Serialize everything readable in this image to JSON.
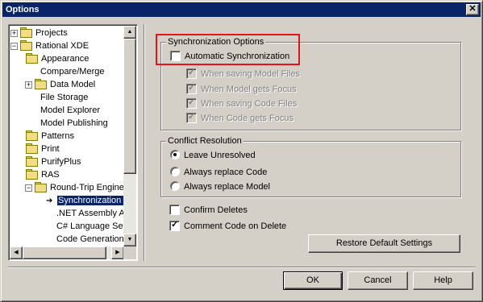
{
  "window": {
    "title": "Options",
    "close_glyph": "✕"
  },
  "tree": {
    "items": [
      {
        "label": "Projects",
        "icon": "folder-icon",
        "expander": "+"
      },
      {
        "label": "Rational XDE",
        "icon": "folder-icon",
        "expander": "−"
      },
      {
        "label": "Appearance",
        "icon": "folder-icon"
      },
      {
        "label": "Compare/Merge"
      },
      {
        "label": "Data Model",
        "icon": "folder-icon",
        "expander": "+"
      },
      {
        "label": "File Storage"
      },
      {
        "label": "Model Explorer"
      },
      {
        "label": "Model Publishing"
      },
      {
        "label": "Patterns",
        "icon": "folder-icon"
      },
      {
        "label": "Print",
        "icon": "folder-icon"
      },
      {
        "label": "PurifyPlus",
        "icon": "folder-icon"
      },
      {
        "label": "RAS",
        "icon": "folder-icon"
      },
      {
        "label": "Round-Trip Engineering",
        "icon": "folder-icon",
        "expander": "−"
      },
      {
        "label": "Synchronization S",
        "icon": "arrow-icon",
        "selected": true
      },
      {
        "label": ".NET Assembly At"
      },
      {
        "label": "C# Language Set"
      },
      {
        "label": "Code Generation"
      }
    ]
  },
  "sync_group": {
    "title": "Synchronization Options",
    "auto_sync": {
      "label": "Automatic Synchronization",
      "checked": false
    },
    "sub_options": [
      {
        "label": "When saving Model Files",
        "checked": true,
        "enabled": false
      },
      {
        "label": "When Model gets Focus",
        "checked": true,
        "enabled": false
      },
      {
        "label": "When saving Code Files",
        "checked": true,
        "enabled": false
      },
      {
        "label": "When Code gets Focus",
        "checked": true,
        "enabled": false
      }
    ]
  },
  "conflict_group": {
    "title": "Conflict Resolution",
    "options": [
      {
        "label": "Leave Unresolved",
        "selected": true
      },
      {
        "label": "Always replace Code",
        "selected": false
      },
      {
        "label": "Always replace Model",
        "selected": false
      }
    ]
  },
  "confirm_deletes": {
    "label": "Confirm Deletes",
    "checked": false
  },
  "comment_code": {
    "label": "Comment Code on Delete",
    "checked": true
  },
  "buttons": {
    "restore": "Restore Default Settings",
    "ok": "OK",
    "cancel": "Cancel",
    "help": "Help"
  },
  "colors": {
    "titlebar": "#0a246a",
    "highlight_box": "#e8131a",
    "dialog_face": "#d4d0c8"
  }
}
